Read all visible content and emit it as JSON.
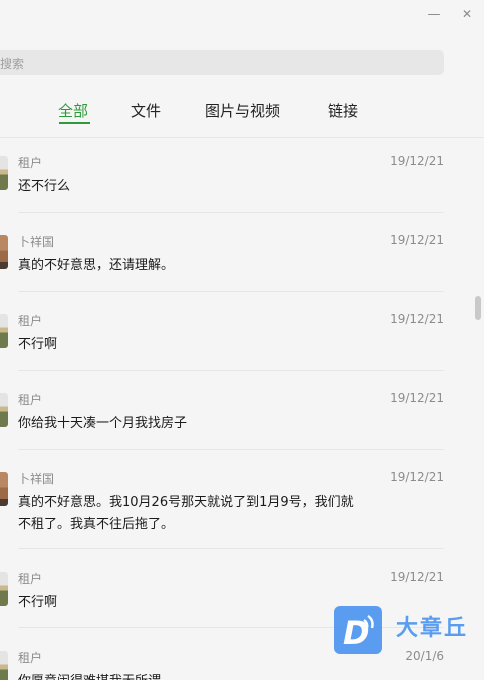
{
  "window": {
    "minimize_icon": "minimize-icon",
    "close_icon": "close-icon"
  },
  "search": {
    "placeholder": "搜索"
  },
  "tabs": [
    {
      "label": "全部",
      "active": true
    },
    {
      "label": "文件",
      "active": false
    },
    {
      "label": "图片与视频",
      "active": false
    },
    {
      "label": "链接",
      "active": false
    }
  ],
  "colors": {
    "accent": "#2d9b3c",
    "watermark": "#3f8ef0"
  },
  "messages": [
    {
      "sender": "租户",
      "date": "19/12/21",
      "text": "还不行么",
      "avatar": "tenant"
    },
    {
      "sender": "卜祥国",
      "date": "19/12/21",
      "text": "真的不好意思，还请理解。",
      "avatar": "landlord"
    },
    {
      "sender": "租户",
      "date": "19/12/21",
      "text": "不行啊",
      "avatar": "tenant"
    },
    {
      "sender": "租户",
      "date": "19/12/21",
      "text": "你给我十天凑一个月我找房子",
      "avatar": "tenant"
    },
    {
      "sender": "卜祥国",
      "date": "19/12/21",
      "text": "真的不好意思。我10月26号那天就说了到1月9号，我们就不租了。我真不往后拖了。",
      "avatar": "landlord"
    },
    {
      "sender": "租户",
      "date": "19/12/21",
      "text": "不行啊",
      "avatar": "tenant"
    },
    {
      "sender": "租户",
      "date": "20/1/6",
      "text": "你愿意闹得难堪我无所谓",
      "avatar": "tenant"
    }
  ],
  "watermark": {
    "text": "大章丘",
    "logo_letter": "D"
  }
}
